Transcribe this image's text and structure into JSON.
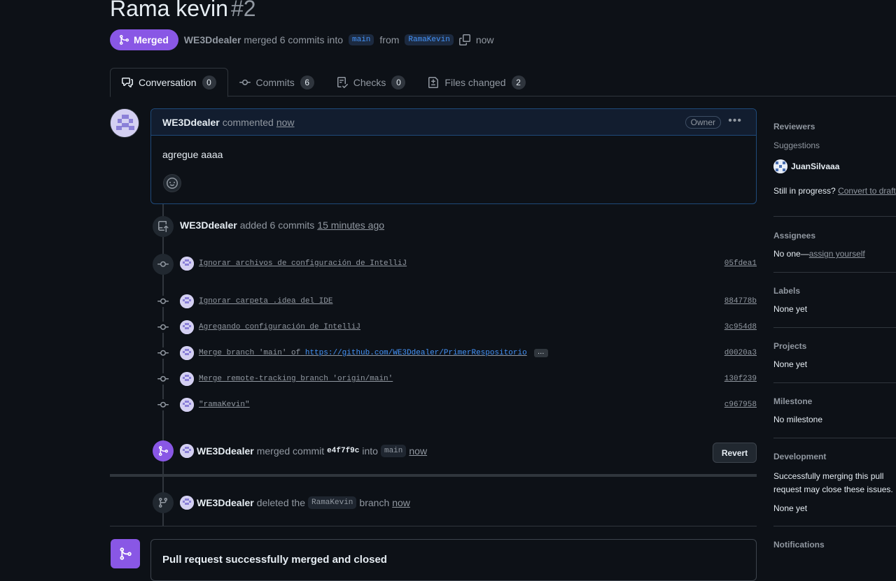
{
  "pr": {
    "title": "Rama kevin",
    "number": "#2",
    "state": "Merged",
    "author": "WE3Ddealer",
    "merge_text": "merged 6 commits into",
    "base_branch": "main",
    "from_text": "from",
    "head_branch": "RamaKevin",
    "time": "now"
  },
  "tabs": [
    {
      "label": "Conversation",
      "count": "0"
    },
    {
      "label": "Commits",
      "count": "6"
    },
    {
      "label": "Checks",
      "count": "0"
    },
    {
      "label": "Files changed",
      "count": "2"
    }
  ],
  "comment": {
    "author": "WE3Ddealer",
    "action": "commented",
    "time": "now",
    "badge": "Owner",
    "body": "agregue aaaa"
  },
  "commits_event": {
    "author": "WE3Ddealer",
    "action": "added 6 commits",
    "time": "15 minutes ago"
  },
  "commits": [
    {
      "message": "Ignorar archivos de configuración de IntelliJ",
      "sha": "05fdea1"
    },
    {
      "message": "Ignorar carpeta .idea del IDE",
      "sha": "884778b"
    },
    {
      "message": "Agregando configuración de IntelliJ",
      "sha": "3c954d8"
    },
    {
      "message": "Merge branch 'main' of",
      "url": "https://github.com/WE3Ddealer/PrimerRespositorio",
      "more": "…",
      "sha": "d0020a3"
    },
    {
      "message": "Merge remote-tracking branch 'origin/main'",
      "sha": "130f239"
    },
    {
      "message": "\"ramaKevin\"",
      "sha": "c967958"
    }
  ],
  "merged_event": {
    "author": "WE3Ddealer",
    "action": "merged commit",
    "sha": "e4f7f9c",
    "into": "into",
    "branch": "main",
    "time": "now",
    "revert_label": "Revert"
  },
  "deleted_event": {
    "author": "WE3Ddealer",
    "action": "deleted the",
    "branch": "RamaKevin",
    "suffix": "branch",
    "time": "now"
  },
  "merge_box": {
    "title": "Pull request successfully merged and closed"
  },
  "sidebar": {
    "reviewers": {
      "heading": "Reviewers",
      "sub": "Suggestions",
      "user": "JuanSilvaaa",
      "progress_text": "Still in progress?",
      "progress_link": "Convert to draft"
    },
    "assignees": {
      "heading": "Assignees",
      "text": "No one—",
      "link": "assign yourself"
    },
    "labels": {
      "heading": "Labels",
      "text": "None yet"
    },
    "projects": {
      "heading": "Projects",
      "text": "None yet"
    },
    "milestone": {
      "heading": "Milestone",
      "text": "No milestone"
    },
    "development": {
      "heading": "Development",
      "text": "Successfully merging this pull request may close these issues.",
      "none": "None yet"
    },
    "notifications": {
      "heading": "Notifications"
    }
  },
  "colors": {
    "background": "#0d1117",
    "merged": "#8957e5",
    "link": "#4493f8",
    "muted": "#9198a1"
  }
}
